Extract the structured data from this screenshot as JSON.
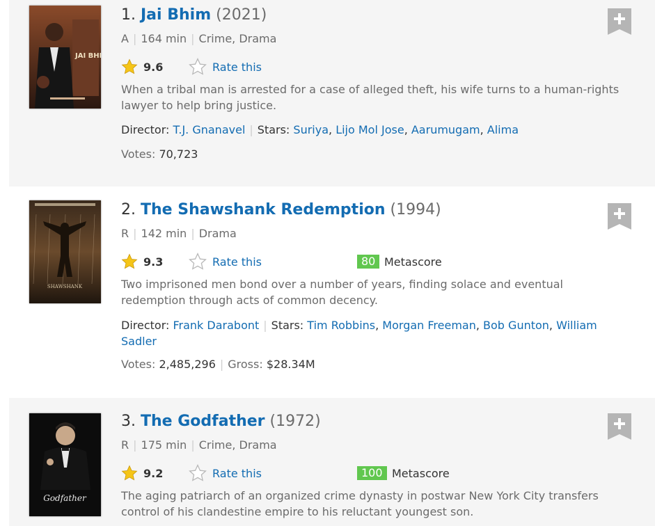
{
  "colors": {
    "link": "#136cb2",
    "metascore_bg": "#61c74f",
    "row_alt": "#f5f5f5",
    "star_gold": "#f5c518"
  },
  "items": [
    {
      "index": "1.",
      "title": "Jai Bhim",
      "year": "(2021)",
      "certificate": "A",
      "runtime": "164 min",
      "genre": "Crime, Drama",
      "rating": "9.6",
      "rate_label": "Rate this",
      "description": "When a tribal man is arrested for a case of alleged theft, his wife turns to a human-rights lawyer to help bring justice.",
      "director_label": "Director:",
      "director": "T.J. Gnanavel",
      "stars_label": "Stars:",
      "stars": [
        "Suriya",
        "Lijo Mol Jose",
        "Aarumugam",
        "Alima"
      ],
      "votes_label": "Votes:",
      "votes": "70,723"
    },
    {
      "index": "2.",
      "title": "The Shawshank Redemption",
      "year": "(1994)",
      "certificate": "R",
      "runtime": "142 min",
      "genre": "Drama",
      "rating": "9.3",
      "rate_label": "Rate this",
      "metascore": "80",
      "metascore_label": "Metascore",
      "description": "Two imprisoned men bond over a number of years, finding solace and eventual redemption through acts of common decency.",
      "director_label": "Director:",
      "director": "Frank Darabont",
      "stars_label": "Stars:",
      "stars": [
        "Tim Robbins",
        "Morgan Freeman",
        "Bob Gunton",
        "William Sadler"
      ],
      "votes_label": "Votes:",
      "votes": "2,485,296",
      "gross_label": "Gross:",
      "gross": "$28.34M"
    },
    {
      "index": "3.",
      "title": "The Godfather",
      "year": "(1972)",
      "certificate": "R",
      "runtime": "175 min",
      "genre": "Crime, Drama",
      "rating": "9.2",
      "rate_label": "Rate this",
      "metascore": "100",
      "metascore_label": "Metascore",
      "description": "The aging patriarch of an organized crime dynasty in postwar New York City transfers control of his clandestine empire to his reluctant youngest son."
    }
  ],
  "icons": {
    "rating_star": "star-filled-icon",
    "rate_star": "star-outline-icon",
    "add": "watchlist-add-icon"
  }
}
